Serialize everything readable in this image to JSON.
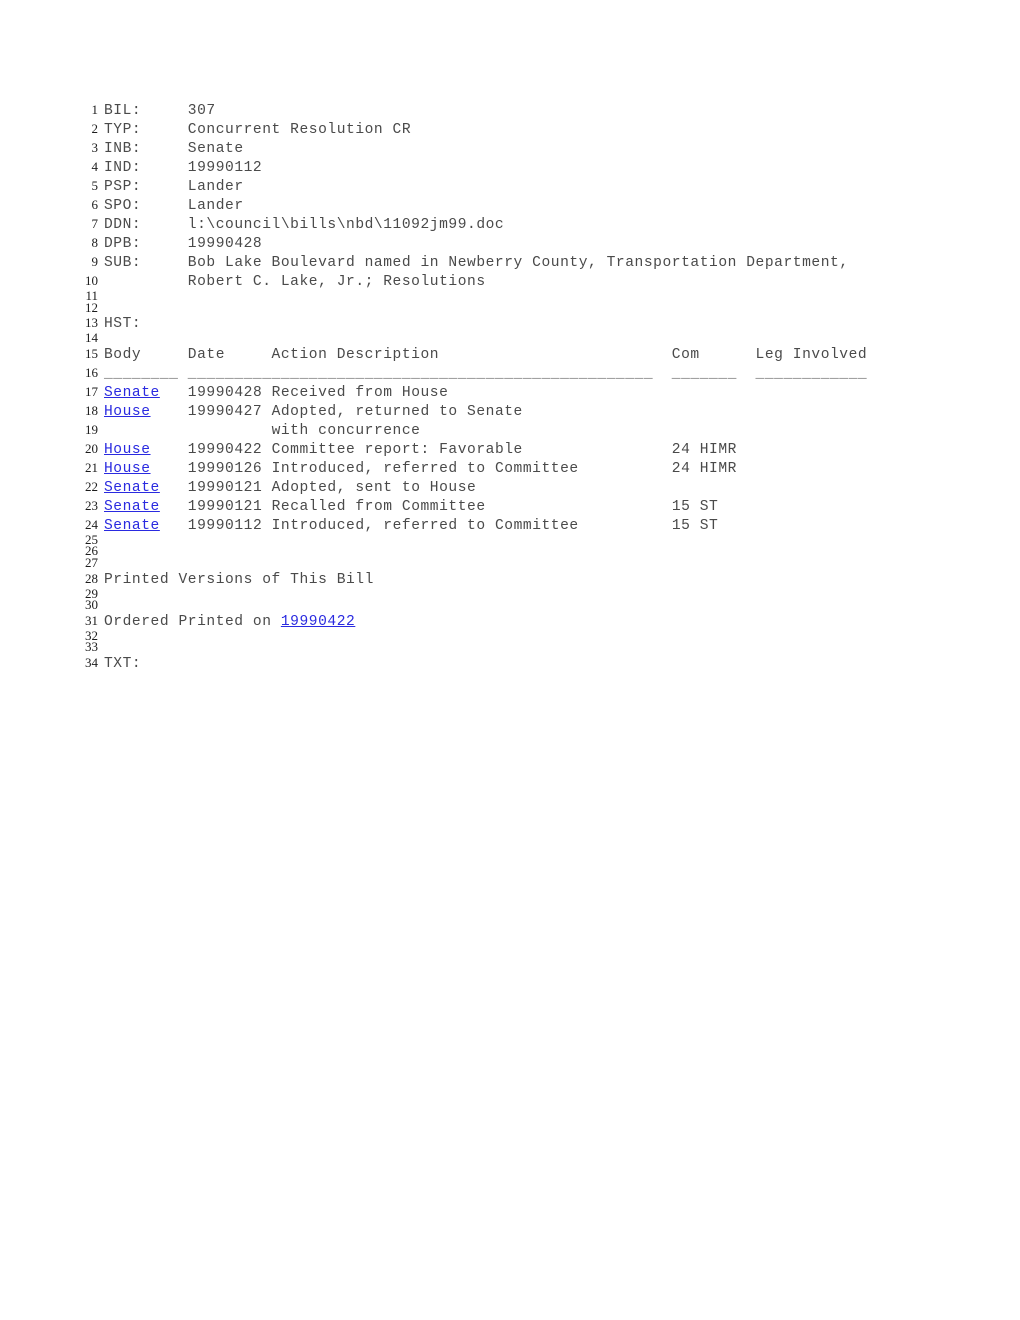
{
  "document": {
    "type": "legislative-bill-status",
    "fields": [
      {
        "line": 1,
        "label": "BIL:",
        "value": "307"
      },
      {
        "line": 2,
        "label": "TYP:",
        "value": "Concurrent Resolution CR"
      },
      {
        "line": 3,
        "label": "INB:",
        "value": "Senate"
      },
      {
        "line": 4,
        "label": "IND:",
        "value": "19990112"
      },
      {
        "line": 5,
        "label": "PSP:",
        "value": "Lander"
      },
      {
        "line": 6,
        "label": "SPO:",
        "value": "Lander"
      },
      {
        "line": 7,
        "label": "DDN:",
        "value": "l:\\council\\bills\\nbd\\11092jm99.doc"
      },
      {
        "line": 8,
        "label": "DPB:",
        "value": "19990428"
      },
      {
        "line": 9,
        "label": "SUB:",
        "value": "Bob Lake Boulevard named in Newberry County, Transportation Department,"
      },
      {
        "line": 10,
        "label": "",
        "value": "Robert C. Lake, Jr.; Resolutions"
      }
    ],
    "history_label": "HST:",
    "history_label_line": 13,
    "history_table": {
      "header_line": 15,
      "rule_line": 16,
      "columns": [
        "Body",
        "Date",
        "Action Description",
        "Com",
        "Leg Involved"
      ],
      "rule": {
        "body": "________",
        "date": "_________",
        "action": "_________________________________________",
        "com": "_______",
        "leg": "____________"
      },
      "rows": [
        {
          "line": 17,
          "body": "Senate",
          "body_link": true,
          "date": "19990428",
          "action": "Received from House",
          "com": "",
          "leg": ""
        },
        {
          "line": 18,
          "body": "House",
          "body_link": true,
          "date": "19990427",
          "action": "Adopted, returned to Senate",
          "com": "",
          "leg": ""
        },
        {
          "line": 19,
          "body": "",
          "body_link": false,
          "date": "",
          "action": "with concurrence",
          "com": "",
          "leg": ""
        },
        {
          "line": 20,
          "body": "House",
          "body_link": true,
          "date": "19990422",
          "action": "Committee report: Favorable",
          "com": "24 HIMR",
          "leg": ""
        },
        {
          "line": 21,
          "body": "House",
          "body_link": true,
          "date": "19990126",
          "action": "Introduced, referred to Committee",
          "com": "24 HIMR",
          "leg": ""
        },
        {
          "line": 22,
          "body": "Senate",
          "body_link": true,
          "date": "19990121",
          "action": "Adopted, sent to House",
          "com": "",
          "leg": ""
        },
        {
          "line": 23,
          "body": "Senate",
          "body_link": true,
          "date": "19990121",
          "action": "Recalled from Committee",
          "com": "15 ST",
          "leg": ""
        },
        {
          "line": 24,
          "body": "Senate",
          "body_link": true,
          "date": "19990112",
          "action": "Introduced, referred to Committee",
          "com": "15 ST",
          "leg": ""
        }
      ]
    },
    "printed_versions": {
      "heading_line": 28,
      "heading": "Printed Versions of This Bill",
      "ordered_line": 31,
      "ordered_prefix": "Ordered Printed on ",
      "ordered_date": "19990422",
      "ordered_date_link": true
    },
    "text_label": "TXT:",
    "text_label_line": 34,
    "blank_lines": [
      11,
      12,
      14,
      25,
      26,
      27,
      29,
      30,
      32,
      33
    ],
    "total_lines": 34,
    "colors": {
      "text": "#4a4a4a",
      "line_number": "#1c1c1c",
      "link": "#2a2ae0",
      "background": "#ffffff",
      "rule": "#6e6e6e"
    }
  }
}
